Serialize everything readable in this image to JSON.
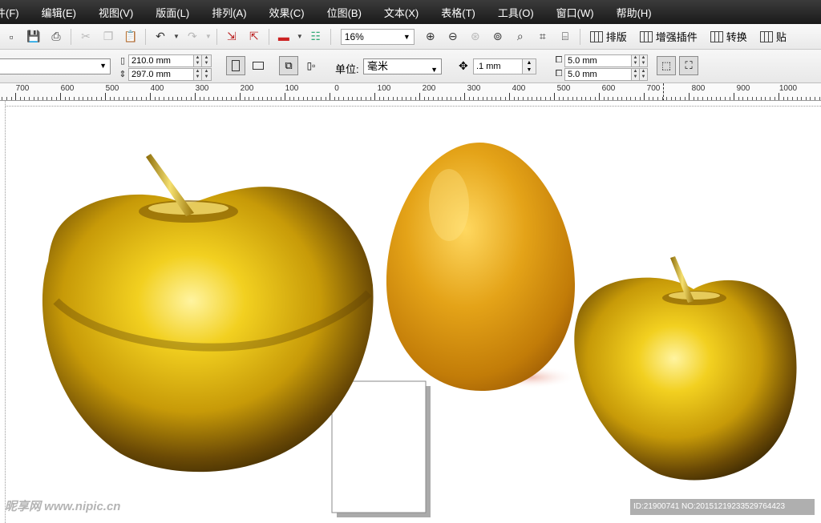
{
  "menu": [
    {
      "label": "件(F)"
    },
    {
      "label": "编辑(E)"
    },
    {
      "label": "视图(V)"
    },
    {
      "label": "版面(L)"
    },
    {
      "label": "排列(A)"
    },
    {
      "label": "效果(C)"
    },
    {
      "label": "位图(B)"
    },
    {
      "label": "文本(X)"
    },
    {
      "label": "表格(T)"
    },
    {
      "label": "工具(O)"
    },
    {
      "label": "窗口(W)"
    },
    {
      "label": "帮助(H)"
    }
  ],
  "toolbar": {
    "zoom": "16%",
    "layout_label": "排版",
    "plugin_label": "增强插件",
    "convert_label": "转换",
    "paste_label": "贴"
  },
  "propbar": {
    "width_value": "210.0 mm",
    "height_value": "297.0 mm",
    "unit_label": "单位:",
    "unit_value": "毫米",
    "nudge_value": ".1 mm",
    "dup_x": "5.0 mm",
    "dup_y": "5.0 mm"
  },
  "ruler": {
    "labels": [
      "700",
      "600",
      "500",
      "400",
      "300",
      "200",
      "100",
      "0",
      "100",
      "200",
      "300",
      "400",
      "500",
      "600",
      "700",
      "800",
      "900",
      "1000"
    ]
  },
  "canvas": {
    "artwork": [
      "golden-apple",
      "golden-egg",
      "golden-apple"
    ]
  },
  "watermark": {
    "site": "昵享网 www.nipic.cn",
    "id_text": "ID:21900741 NO:20151219233529764423"
  },
  "colors": {
    "gold": "#d4a417",
    "menubar": "#1a1a1a"
  }
}
